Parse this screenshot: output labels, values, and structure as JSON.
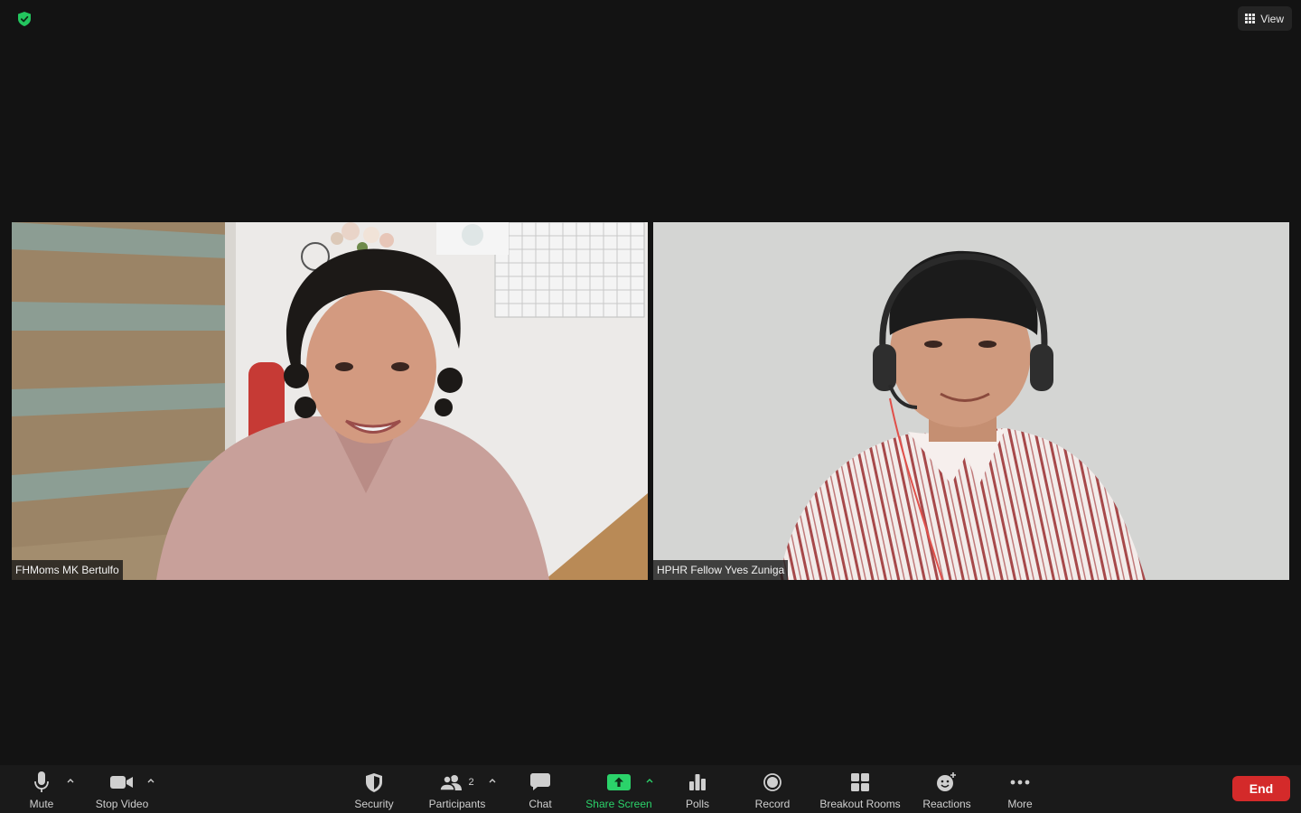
{
  "header": {
    "view_label": "View",
    "encryption_icon": "shield-check-icon"
  },
  "participants_tiles": [
    {
      "name": "FHMoms MK Bertulfo"
    },
    {
      "name": "HPHR Fellow Yves Zuniga"
    }
  ],
  "toolbar": {
    "mute_label": "Mute",
    "stop_video_label": "Stop Video",
    "security_label": "Security",
    "participants_label": "Participants",
    "participants_count": "2",
    "chat_label": "Chat",
    "share_screen_label": "Share Screen",
    "polls_label": "Polls",
    "record_label": "Record",
    "breakout_label": "Breakout Rooms",
    "reactions_label": "Reactions",
    "more_label": "More",
    "end_label": "End"
  },
  "colors": {
    "background": "#131313",
    "toolbar": "#1a1a1a",
    "accent_green": "#2bd36a",
    "end_red": "#d42a2a"
  }
}
